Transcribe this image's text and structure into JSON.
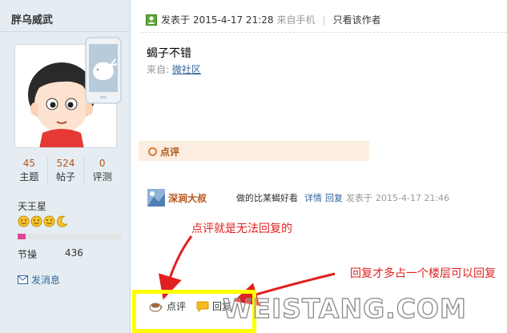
{
  "sidebar": {
    "username": "胖乌威武",
    "stats": [
      {
        "value": "45",
        "label": "主题"
      },
      {
        "value": "524",
        "label": "帖子"
      },
      {
        "value": "0",
        "label": "评测"
      }
    ],
    "rank_title": "天王星",
    "rank_icons": [
      "smile-icon",
      "smile-icon",
      "smile-icon",
      "moon-icon"
    ],
    "rank_progress": 0.08,
    "jiecao_label": "节操",
    "jiecao_value": "436",
    "send_message": "发消息"
  },
  "post": {
    "posted_label": "发表于",
    "time": "2015-4-17 21:28",
    "from": "来自手机",
    "separator": "|",
    "only_author": "只看该作者",
    "body": "蝎子不错",
    "source_prefix": "来自:",
    "source_link": "微社区"
  },
  "comment_tab": "点评",
  "reply": {
    "user": "深涧大叔",
    "text": "做的比某蝎好看",
    "link_detail": "详情",
    "link_reply": "回复",
    "posted_label": "发表于",
    "time": "2015-4-17 21:46"
  },
  "annotations": {
    "left": "点评就是无法回复的",
    "right": "回复才多占一个楼层可以回复"
  },
  "actions": {
    "comment": "点评",
    "reply": "回复"
  },
  "watermark": "WEISTANG.COM",
  "colors": {
    "sidebar_bg": "#e5edf2",
    "accent_brown": "#b4541a",
    "link_blue": "#336699",
    "annotation_red": "#e02020",
    "highlight_yellow": "#ffff00"
  }
}
